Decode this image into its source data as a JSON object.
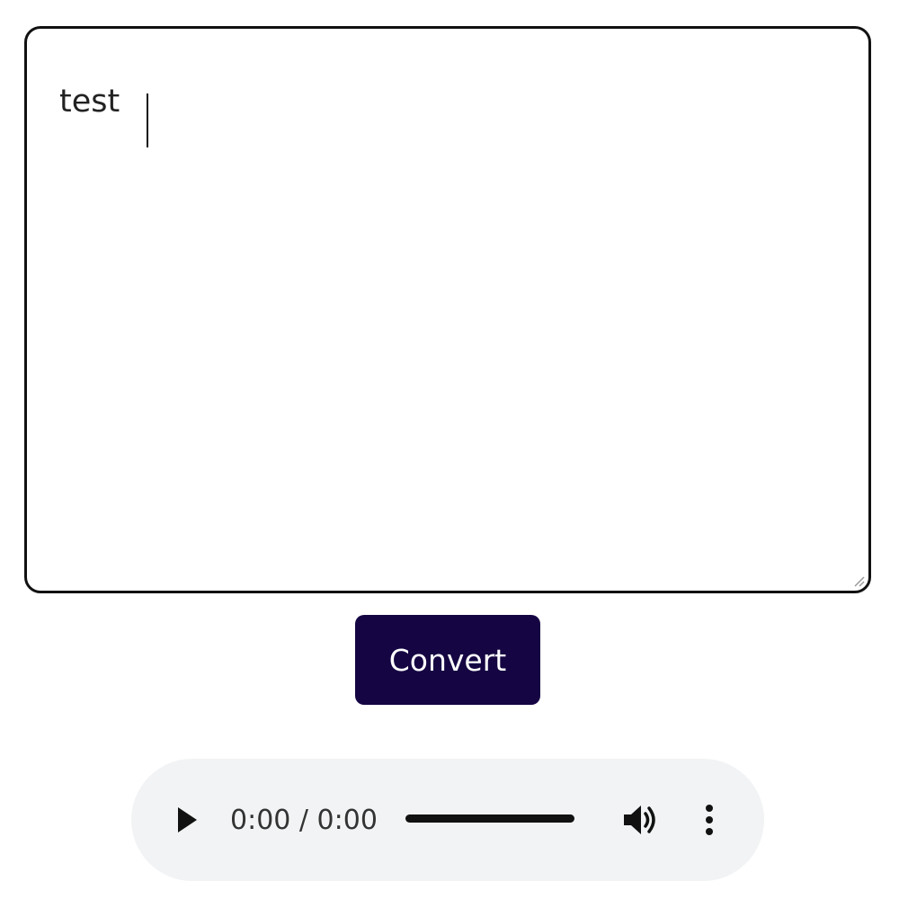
{
  "editor": {
    "value": "test"
  },
  "convert_button": {
    "label": "Convert",
    "color": "#150542"
  },
  "audio_player": {
    "time": "0:00 / 0:00",
    "icons": {
      "play": "play-icon",
      "volume": "volume-icon",
      "more": "more-options-icon"
    },
    "background": "#f1f3f4"
  }
}
